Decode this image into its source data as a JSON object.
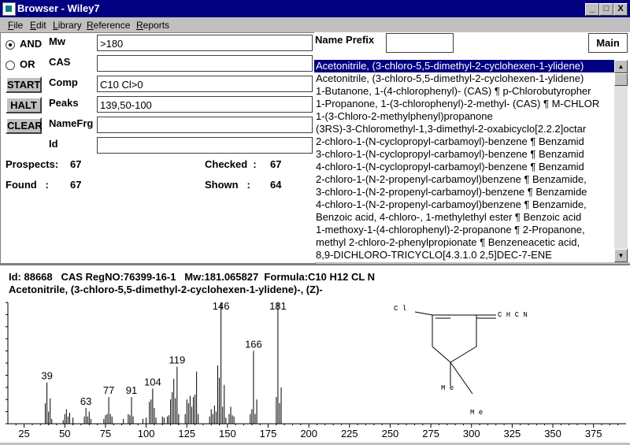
{
  "window": {
    "title": "Browser - Wiley7",
    "min_label": "_",
    "max_label": "□",
    "close_label": "X"
  },
  "menu": [
    {
      "first": "F",
      "rest": "ile"
    },
    {
      "first": "E",
      "rest": "dit"
    },
    {
      "first": "L",
      "rest": "ibrary"
    },
    {
      "first": "R",
      "rest": "eference"
    },
    {
      "first": "R",
      "rest": "eports"
    }
  ],
  "search": {
    "and_label": "AND",
    "or_label": "OR",
    "and_selected": true,
    "fields": [
      {
        "label": "Mw",
        "value": ">180"
      },
      {
        "label": "CAS",
        "value": ""
      },
      {
        "label": "Comp",
        "value": "C10 Cl>0"
      },
      {
        "label": "Peaks",
        "value": "139,50-100"
      },
      {
        "label": "NameFrg",
        "value": ""
      },
      {
        "label": "Id",
        "value": ""
      }
    ],
    "buttons": {
      "start": "START",
      "halt": "HALT",
      "clear": "CLEAR"
    }
  },
  "stats": {
    "prospects_label": "Prospects:",
    "prospects": "67",
    "checked_label": "Checked  :",
    "checked": "67",
    "found_label": "Found   :",
    "found": "67",
    "shown_label": "Shown   :",
    "shown": "64"
  },
  "results": {
    "name_prefix_label": "Name Prefix",
    "name_prefix_value": "",
    "main_label": "Main",
    "items": [
      "Acetonitrile, (3-chloro-5,5-dimethyl-2-cyclohexen-1-ylidene)",
      "Acetonitrile, (3-chloro-5,5-dimethyl-2-cyclohexen-1-ylidene)",
      "1-Butanone, 1-(4-chlorophenyl)- (CAS) ¶ p-Chlorobutyropher",
      "1-Propanone, 1-(3-chlorophenyl)-2-methyl- (CAS) ¶ M-CHLOR",
      "1-(3-Chloro-2-methylphenyl)propanone",
      "(3RS)-3-Chloromethyl-1,3-dimethyl-2-oxabicyclo[2.2.2]octar",
      "2-chloro-1-(N-cyclopropyl-carbamoyl)-benzene ¶ Benzamid",
      "3-chloro-1-(N-cyclopropyl-carbamoyl)-benzene ¶ Benzamid",
      "4-chloro-1-(N-cyclopropyl-carbamoyl)-benzene ¶ Benzamid",
      "2-chloro-1-(N-2-propenyl-carbamoyl)benzene ¶ Benzamide,",
      "3-chloro-1-(N-2-propenyl-carbamoyl)-benzene ¶ Benzamide",
      "4-chloro-1-(N-2-propenyl-carbamoyl)benzene ¶ Benzamide,",
      "Benzoic acid, 4-chloro-, 1-methylethyl ester ¶ Benzoic acid",
      "1-methoxy-1-(4-chlorophenyl)-2-propanone ¶ 2-Propanone,",
      "methyl 2-chloro-2-phenylpropionate ¶ Benzeneacetic acid,",
      "8,9-DICHLORO-TRICYCLO[4.3.1.0 2,5]DEC-7-ENE"
    ],
    "selected_index": 0
  },
  "compound": {
    "info": "Id: 88668   CAS RegNO:76399-16-1   Mw:181.065827  Formula:C10 H12 CL N",
    "name": "Acetonitrile, (3-chloro-5,5-dimethyl-2-cyclohexen-1-ylidene)-, (Z)-",
    "struct_labels": {
      "cl": "C l",
      "chcn": "C H C N",
      "me1": "M e",
      "me2": "M e"
    }
  },
  "chart_data": {
    "type": "bar",
    "xlabel": "",
    "ylabel": "",
    "xlim": [
      15,
      395
    ],
    "ylim": [
      0,
      100
    ],
    "x_ticks": [
      25,
      50,
      75,
      100,
      125,
      150,
      175,
      200,
      225,
      250,
      275,
      300,
      325,
      350,
      375
    ],
    "labeled_peaks": [
      {
        "mz": 39,
        "label": "39"
      },
      {
        "mz": 63,
        "label": "63"
      },
      {
        "mz": 77,
        "label": "77"
      },
      {
        "mz": 91,
        "label": "91"
      },
      {
        "mz": 104,
        "label": "104"
      },
      {
        "mz": 119,
        "label": "119"
      },
      {
        "mz": 146,
        "label": "146"
      },
      {
        "mz": 166,
        "label": "166"
      },
      {
        "mz": 181,
        "label": "181"
      }
    ],
    "peaks": [
      {
        "mz": 38,
        "y": 17
      },
      {
        "mz": 39,
        "y": 34
      },
      {
        "mz": 40,
        "y": 10
      },
      {
        "mz": 41,
        "y": 21
      },
      {
        "mz": 42,
        "y": 4
      },
      {
        "mz": 49,
        "y": 3
      },
      {
        "mz": 50,
        "y": 8
      },
      {
        "mz": 51,
        "y": 12
      },
      {
        "mz": 52,
        "y": 6
      },
      {
        "mz": 53,
        "y": 9
      },
      {
        "mz": 55,
        "y": 5
      },
      {
        "mz": 62,
        "y": 6
      },
      {
        "mz": 63,
        "y": 13
      },
      {
        "mz": 64,
        "y": 6
      },
      {
        "mz": 65,
        "y": 10
      },
      {
        "mz": 66,
        "y": 4
      },
      {
        "mz": 74,
        "y": 4
      },
      {
        "mz": 75,
        "y": 7
      },
      {
        "mz": 76,
        "y": 8
      },
      {
        "mz": 77,
        "y": 22
      },
      {
        "mz": 78,
        "y": 8
      },
      {
        "mz": 79,
        "y": 6
      },
      {
        "mz": 86,
        "y": 4
      },
      {
        "mz": 89,
        "y": 8
      },
      {
        "mz": 90,
        "y": 7
      },
      {
        "mz": 91,
        "y": 22
      },
      {
        "mz": 92,
        "y": 6
      },
      {
        "mz": 98,
        "y": 4
      },
      {
        "mz": 100,
        "y": 5
      },
      {
        "mz": 102,
        "y": 18
      },
      {
        "mz": 103,
        "y": 20
      },
      {
        "mz": 104,
        "y": 29
      },
      {
        "mz": 105,
        "y": 13
      },
      {
        "mz": 106,
        "y": 5
      },
      {
        "mz": 110,
        "y": 6
      },
      {
        "mz": 111,
        "y": 5
      },
      {
        "mz": 113,
        "y": 6
      },
      {
        "mz": 114,
        "y": 7
      },
      {
        "mz": 115,
        "y": 20
      },
      {
        "mz": 116,
        "y": 26
      },
      {
        "mz": 117,
        "y": 37
      },
      {
        "mz": 118,
        "y": 21
      },
      {
        "mz": 119,
        "y": 47
      },
      {
        "mz": 120,
        "y": 8
      },
      {
        "mz": 124,
        "y": 8
      },
      {
        "mz": 125,
        "y": 20
      },
      {
        "mz": 126,
        "y": 17
      },
      {
        "mz": 127,
        "y": 23
      },
      {
        "mz": 128,
        "y": 14
      },
      {
        "mz": 129,
        "y": 22
      },
      {
        "mz": 130,
        "y": 24
      },
      {
        "mz": 131,
        "y": 43
      },
      {
        "mz": 132,
        "y": 8
      },
      {
        "mz": 139,
        "y": 6
      },
      {
        "mz": 140,
        "y": 12
      },
      {
        "mz": 141,
        "y": 8
      },
      {
        "mz": 142,
        "y": 15
      },
      {
        "mz": 143,
        "y": 10
      },
      {
        "mz": 144,
        "y": 48
      },
      {
        "mz": 145,
        "y": 38
      },
      {
        "mz": 146,
        "y": 100
      },
      {
        "mz": 147,
        "y": 14
      },
      {
        "mz": 148,
        "y": 32
      },
      {
        "mz": 149,
        "y": 5
      },
      {
        "mz": 151,
        "y": 8
      },
      {
        "mz": 152,
        "y": 14
      },
      {
        "mz": 153,
        "y": 7
      },
      {
        "mz": 154,
        "y": 6
      },
      {
        "mz": 164,
        "y": 8
      },
      {
        "mz": 165,
        "y": 12
      },
      {
        "mz": 166,
        "y": 60
      },
      {
        "mz": 167,
        "y": 8
      },
      {
        "mz": 168,
        "y": 20
      },
      {
        "mz": 180,
        "y": 22
      },
      {
        "mz": 181,
        "y": 100
      },
      {
        "mz": 182,
        "y": 17
      },
      {
        "mz": 183,
        "y": 30
      }
    ]
  }
}
